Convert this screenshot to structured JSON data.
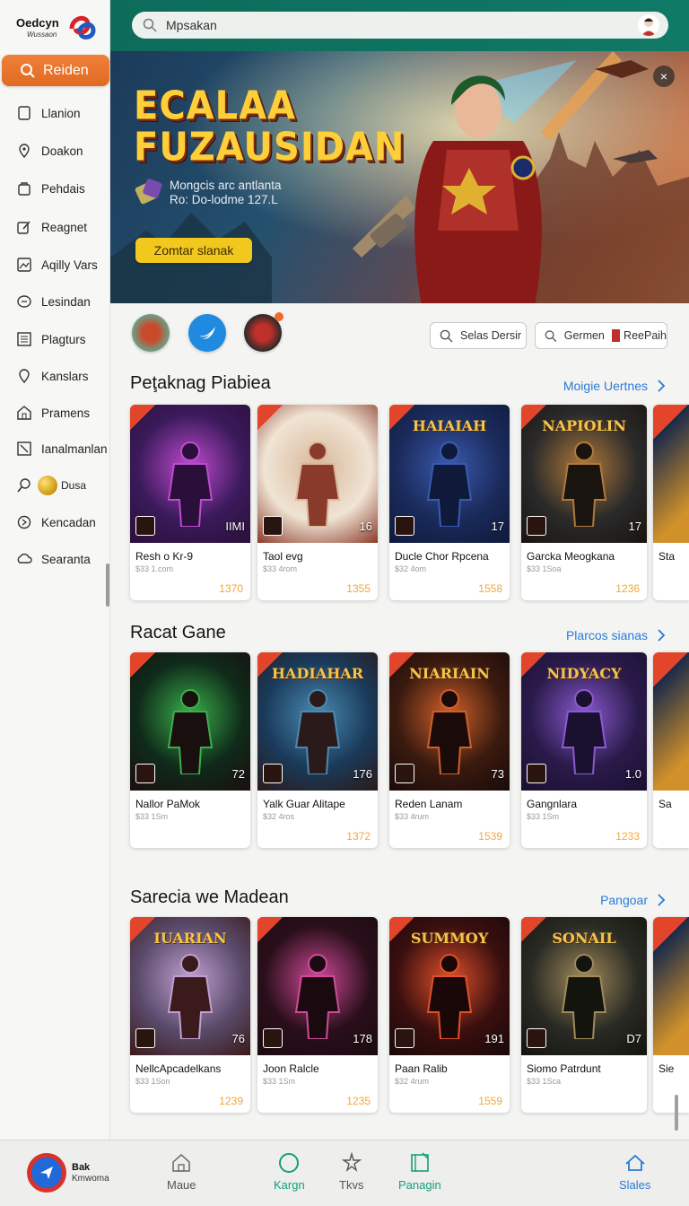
{
  "brand": {
    "name": "Oedcyn",
    "sub": "Wussaon"
  },
  "search": {
    "placeholder": "Mpsakan"
  },
  "sidebar": {
    "search_label": "Reiden",
    "items": [
      {
        "label": "Llanion",
        "icon": "square-icon"
      },
      {
        "label": "Doakon",
        "icon": "location-pin-icon"
      },
      {
        "label": "Pehdais",
        "icon": "bag-icon"
      },
      {
        "label": "Reagnet",
        "icon": "edit-icon"
      },
      {
        "label": "Aqilly Vars",
        "icon": "image-icon"
      },
      {
        "label": "Lesindan",
        "icon": "chat-icon"
      },
      {
        "label": "Plagturs",
        "icon": "grid-icon"
      },
      {
        "label": "Kanslars",
        "icon": "tag-icon"
      },
      {
        "label": "Pramens",
        "icon": "home-icon"
      },
      {
        "label": "Ianalmanlan",
        "icon": "close-box-icon"
      },
      {
        "label": "Dusa",
        "icon": "search-icon"
      },
      {
        "label": "Kencadan",
        "icon": "gear-icon"
      },
      {
        "label": "Searanta",
        "icon": "cloud-icon"
      }
    ]
  },
  "hero": {
    "title_line1": "ECALAA",
    "title_line2": "FUZAUSIDAN",
    "sub_line1": "Mongcis arc antlanta",
    "sub_line2": "Ro: Do-lodme 127.L",
    "cta": "Zomtar slanak",
    "close": "×"
  },
  "filters": {
    "chip1": "Selas Dersir",
    "chip2": "Germen",
    "chip2_extra": "ReePaih"
  },
  "sections": [
    {
      "title": "Peţaknag Piabiea",
      "more": "Moigie Uertnes",
      "cards": [
        {
          "name": "Resh o Kr-9",
          "sub": "$33 1.com",
          "price": "1370",
          "num": "IIMI",
          "art_title": "",
          "colors": [
            "#3a1a5a",
            "#c04ad0",
            "#2a0f3a"
          ]
        },
        {
          "name": "Taol evg",
          "sub": "$33 4rom",
          "price": "1355",
          "num": "16",
          "art_title": "",
          "colors": [
            "#f0e4d4",
            "#d8b89a",
            "#8a3a2a"
          ]
        },
        {
          "name": "Ducle Chor Rpcena",
          "sub": "$32 4om",
          "price": "1558",
          "num": "17",
          "art_title": "HAIAIAH",
          "colors": [
            "#1a2a5a",
            "#3a5ab0",
            "#0f1a3a"
          ]
        },
        {
          "name": "Garcka Meogkana",
          "sub": "$33 1Soa",
          "price": "1236",
          "num": "17",
          "art_title": "NAPIOLIN",
          "colors": [
            "#2a2a2a",
            "#b07a3a",
            "#1a1410"
          ]
        }
      ]
    },
    {
      "title": "Racat Gane",
      "more": "Plarcos sianas",
      "cards": [
        {
          "name": "Nallor PaMok",
          "sub": "$33 1Sm",
          "price": "",
          "num": "72",
          "art_title": "",
          "colors": [
            "#0f2a1a",
            "#3ab04a",
            "#1a0f0f"
          ]
        },
        {
          "name": "Yalk Guar Alitape",
          "sub": "$32 4ros",
          "price": "1372",
          "num": "176",
          "art_title": "HADIAHAR",
          "colors": [
            "#1a3a5a",
            "#4a8ab0",
            "#2a1a1a"
          ]
        },
        {
          "name": "Reden Lanam",
          "sub": "$33 4rum",
          "price": "1539",
          "num": "73",
          "art_title": "NIARIAIN",
          "colors": [
            "#3a1a0f",
            "#d0602a",
            "#1a0a0a"
          ]
        },
        {
          "name": "Gangnlara",
          "sub": "$33 1Sm",
          "price": "1233",
          "num": "1.0",
          "art_title": "NIDYACY",
          "colors": [
            "#2a1a4a",
            "#8a5ad0",
            "#1a1030"
          ]
        }
      ]
    },
    {
      "title": "Sarecia we Madean",
      "more": "Pangoar",
      "cards": [
        {
          "name": "NellcApcadelkans",
          "sub": "$33 1Son",
          "price": "1239",
          "num": "76",
          "art_title": "IUARIAN",
          "colors": [
            "#5a4a6a",
            "#c0a0d0",
            "#3a1a1a"
          ]
        },
        {
          "name": "Joon Ralcle",
          "sub": "$33 1Sm",
          "price": "1235",
          "num": "178",
          "art_title": "",
          "colors": [
            "#2a0f1a",
            "#d04a9a",
            "#1a0a10"
          ]
        },
        {
          "name": "Paan Ralib",
          "sub": "$32 4rum",
          "price": "1559",
          "num": "191",
          "art_title": "SUMMOY",
          "colors": [
            "#3a0f0f",
            "#e0502a",
            "#1a0808"
          ]
        },
        {
          "name": "Siomo Patrdunt",
          "sub": "$33 1Sca",
          "price": "",
          "num": "D7",
          "art_title": "SONAIL",
          "colors": [
            "#2a2a24",
            "#a08a5a",
            "#14140f"
          ]
        }
      ]
    }
  ],
  "edge_labels": [
    "Sta",
    "Sa",
    "Sie"
  ],
  "bottom_nav": {
    "profile_line1": "Bak",
    "profile_line2": "Kmwoma",
    "items": [
      {
        "label": "Maue",
        "icon": "home-icon",
        "active": false
      },
      {
        "label": "Kargn",
        "icon": "circle-icon",
        "active": true
      },
      {
        "label": "Tkvs",
        "icon": "star-icon",
        "active": false
      },
      {
        "label": "Panagin",
        "icon": "book-icon",
        "active": true
      },
      {
        "label": "Slales",
        "icon": "house-outline-icon",
        "active": false
      }
    ]
  },
  "colors": {
    "accent": "#e9722c",
    "topbar": "#0e725f",
    "link": "#2a7bd6",
    "price": "#f0a83a",
    "active_nav": "#13a07a",
    "blue_nav": "#2a7bd6"
  }
}
